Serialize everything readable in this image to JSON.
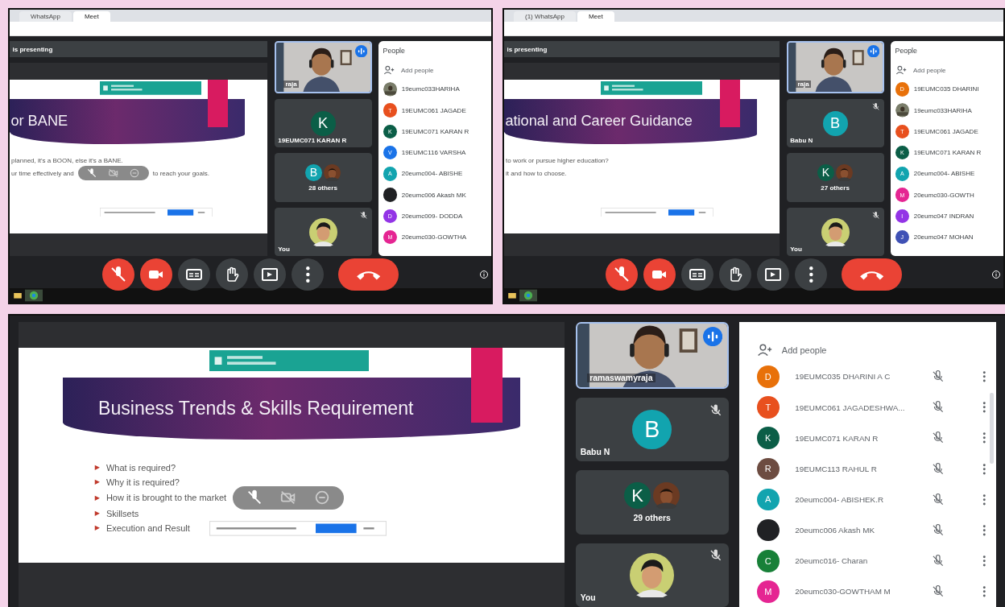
{
  "panels": [
    {
      "kind": "top",
      "tabs": [
        {
          "label": "WhatsApp",
          "selected": false
        },
        {
          "label": "Meet",
          "selected": true
        }
      ],
      "presenter": "is presenting",
      "slide": {
        "title": "or BANE",
        "rows": [
          {
            "kind": "line",
            "text": "planned, it's a BOON, else it's a BANE.",
            "toolbar": false
          },
          {
            "kind": "line",
            "text": "ur time effectively and",
            "toolbar": true,
            "text_after": "to reach your goals."
          }
        ]
      },
      "tiles": [
        {
          "kind": "video",
          "name": "raja",
          "speaking": true
        },
        {
          "kind": "avatar",
          "letter": "K",
          "color": "#0b5e47",
          "name": "19EUMC071 KARAN R",
          "muted": false
        },
        {
          "kind": "group",
          "letter": "B",
          "color": "#12a4af",
          "name": "28 others"
        },
        {
          "kind": "self",
          "name": "You",
          "muted": true
        }
      ],
      "people": {
        "title": "People",
        "add": "Add people",
        "members": [
          {
            "name": "19eumc033HARIHA"
          },
          {
            "kind": "letter",
            "letter": "T",
            "color": "#e8501e",
            "name": "19EUMC061 JAGADE"
          },
          {
            "kind": "letter",
            "letter": "K",
            "color": "#0b5e47",
            "name": "19EUMC071 KARAN R"
          },
          {
            "kind": "letter",
            "letter": "V",
            "color": "#1a73e8",
            "name": "19EUMC116 VARSHA"
          },
          {
            "kind": "letter",
            "letter": "A",
            "color": "#12a4af",
            "name": "20eumc004- ABISHE"
          },
          {
            "kind": "letter",
            "color": "#202124",
            "name": "20eumc006 Akash MK"
          },
          {
            "kind": "letter",
            "letter": "D",
            "color": "#9334e6",
            "name": "20eumc009- DODDA"
          },
          {
            "kind": "letter",
            "letter": "M",
            "color": "#e52592",
            "name": "20eumc030-GOWTHA"
          }
        ]
      },
      "controls": [
        {
          "kind": "mic",
          "off": true
        },
        {
          "kind": "camera",
          "off": true
        },
        {
          "kind": "captions",
          "off": false
        },
        {
          "kind": "hand",
          "off": false
        },
        {
          "kind": "present",
          "off": false
        },
        {
          "kind": "more",
          "off": false
        },
        {
          "kind": "hangup",
          "off": true
        }
      ]
    },
    {
      "kind": "top",
      "tabs": [
        {
          "label": "(1) WhatsApp",
          "selected": false
        },
        {
          "label": "Meet",
          "selected": true
        }
      ],
      "presenter": "is presenting",
      "slide": {
        "title": "ational and Career Guidance",
        "rows": [
          {
            "kind": "line",
            "text": "to work or pursue higher education?",
            "toolbar": false
          },
          {
            "kind": "line",
            "text": "it and how to choose.",
            "toolbar": false
          }
        ]
      },
      "tiles": [
        {
          "kind": "video",
          "name": "raja",
          "speaking": true
        },
        {
          "kind": "avatar",
          "letter": "B",
          "color": "#12a4af",
          "name": "Babu N",
          "muted": true
        },
        {
          "kind": "group",
          "letter": "K",
          "color": "#0b5e47",
          "name": "27 others"
        },
        {
          "kind": "self",
          "name": "You",
          "muted": true
        }
      ],
      "people": {
        "title": "People",
        "add": "Add people",
        "members": [
          {
            "kind": "letter",
            "letter": "D",
            "color": "#e8710a",
            "name": "19EUMC035 DHARINI"
          },
          {
            "name": "19eumc033HARIHA"
          },
          {
            "kind": "letter",
            "letter": "T",
            "color": "#e8501e",
            "name": "19EUMC061 JAGADE"
          },
          {
            "kind": "letter",
            "letter": "K",
            "color": "#0b5e47",
            "name": "19EUMC071 KARAN R"
          },
          {
            "kind": "letter",
            "letter": "A",
            "color": "#12a4af",
            "name": "20eumc004- ABISHE"
          },
          {
            "kind": "letter",
            "letter": "M",
            "color": "#e52592",
            "name": "20eumc030-GOWTH"
          },
          {
            "kind": "letter",
            "letter": "I",
            "color": "#9334e6",
            "name": "20eumc047 INDRAN"
          },
          {
            "kind": "letter",
            "letter": "J",
            "color": "#3f51b5",
            "name": "20eumc047 MOHAN"
          }
        ]
      },
      "controls": [
        {
          "kind": "mic",
          "off": true
        },
        {
          "kind": "camera",
          "off": true
        },
        {
          "kind": "captions",
          "off": false
        },
        {
          "kind": "hand",
          "off": false
        },
        {
          "kind": "present",
          "off": false
        },
        {
          "kind": "more",
          "off": false
        },
        {
          "kind": "hangup",
          "off": true
        }
      ]
    },
    {
      "kind": "bottom",
      "slide": {
        "title": "Business Trends & Skills Requirement",
        "rows": [
          {
            "kind": "bullet",
            "text": "What is required?",
            "toolbar": false
          },
          {
            "kind": "bullet",
            "text": "Why it is required?",
            "toolbar": false
          },
          {
            "kind": "bullet",
            "text": "How it is brought to the market",
            "toolbar": true
          },
          {
            "kind": "bullet",
            "text": "Skillsets",
            "toolbar": false
          },
          {
            "kind": "bullet",
            "text": "Execution and Result",
            "toolbar": false
          }
        ]
      },
      "tiles": [
        {
          "kind": "video",
          "name": "ramaswamyraja",
          "speaking": true
        },
        {
          "kind": "avatar",
          "letter": "B",
          "color": "#12a4af",
          "name": "Babu N",
          "muted": true
        },
        {
          "kind": "group",
          "letter": "K",
          "color": "#0b5e47",
          "name": "29 others"
        },
        {
          "kind": "self",
          "name": "You",
          "muted": true
        }
      ],
      "people": {
        "add": "Add people",
        "actions": true,
        "members": [
          {
            "kind": "letter",
            "letter": "D",
            "color": "#e8710a",
            "name": "19EUMC035 DHARINI A C",
            "muted": true
          },
          {
            "kind": "letter",
            "letter": "T",
            "color": "#e8501e",
            "name": "19EUMC061 JAGADESHWA...",
            "muted": true
          },
          {
            "kind": "letter",
            "letter": "K",
            "color": "#0b5e47",
            "name": "19EUMC071 KARAN R",
            "muted": true
          },
          {
            "kind": "letter",
            "letter": "R",
            "color": "#6d4c41",
            "name": "19EUMC113 RAHUL R",
            "muted": true
          },
          {
            "kind": "letter",
            "letter": "A",
            "color": "#12a4af",
            "name": "20eumc004- ABISHEK.R",
            "muted": true
          },
          {
            "kind": "letter",
            "color": "#202124",
            "name": "20eumc006 Akash MK",
            "muted": true
          },
          {
            "kind": "letter",
            "letter": "C",
            "color": "#188038",
            "name": "20eumc016- Charan",
            "muted": true
          },
          {
            "kind": "letter",
            "letter": "M",
            "color": "#e52592",
            "name": "20eumc030-GOWTHAM M",
            "muted": true
          }
        ]
      }
    }
  ]
}
